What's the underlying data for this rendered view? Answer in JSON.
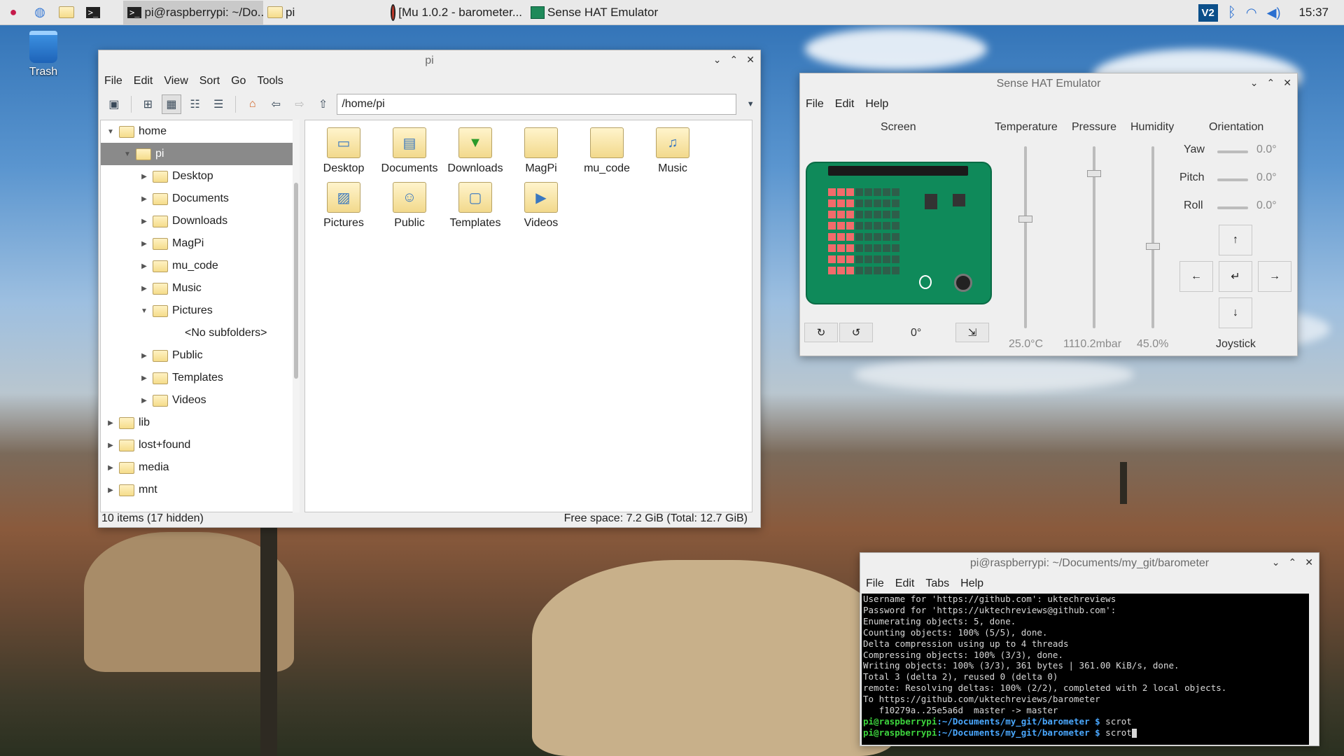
{
  "taskbar": {
    "tasks": [
      {
        "label": "pi@raspberrypi: ~/Do...",
        "active": true
      },
      {
        "label": "pi",
        "active": false
      },
      {
        "label": "[Mu 1.0.2 - barometer...",
        "active": false
      },
      {
        "label": "Sense HAT Emulator",
        "active": false
      }
    ],
    "clock": "15:37"
  },
  "desktop": {
    "trash_label": "Trash"
  },
  "file_manager": {
    "title": "pi",
    "menu": [
      "File",
      "Edit",
      "View",
      "Sort",
      "Go",
      "Tools"
    ],
    "address": "/home/pi",
    "tree": [
      {
        "label": "home",
        "level": 0,
        "expanded": true,
        "selected": false
      },
      {
        "label": "pi",
        "level": 1,
        "expanded": true,
        "selected": true
      },
      {
        "label": "Desktop",
        "level": 2,
        "expanded": false,
        "selected": false
      },
      {
        "label": "Documents",
        "level": 2,
        "expanded": false,
        "selected": false
      },
      {
        "label": "Downloads",
        "level": 2,
        "expanded": false,
        "selected": false
      },
      {
        "label": "MagPi",
        "level": 2,
        "expanded": false,
        "selected": false
      },
      {
        "label": "mu_code",
        "level": 2,
        "expanded": false,
        "selected": false
      },
      {
        "label": "Music",
        "level": 2,
        "expanded": false,
        "selected": false
      },
      {
        "label": "Pictures",
        "level": 2,
        "expanded": true,
        "selected": false
      },
      {
        "label": "<No subfolders>",
        "level": 3,
        "expanded": false,
        "selected": false
      },
      {
        "label": "Public",
        "level": 2,
        "expanded": false,
        "selected": false
      },
      {
        "label": "Templates",
        "level": 2,
        "expanded": false,
        "selected": false
      },
      {
        "label": "Videos",
        "level": 2,
        "expanded": false,
        "selected": false
      },
      {
        "label": "lib",
        "level": 0,
        "expanded": false,
        "selected": false
      },
      {
        "label": "lost+found",
        "level": 0,
        "expanded": false,
        "selected": false
      },
      {
        "label": "media",
        "level": 0,
        "expanded": false,
        "selected": false
      },
      {
        "label": "mnt",
        "level": 0,
        "expanded": false,
        "selected": false
      }
    ],
    "files": [
      {
        "label": "Desktop",
        "icon": "desktop-folder-icon"
      },
      {
        "label": "Documents",
        "icon": "documents-folder-icon"
      },
      {
        "label": "Downloads",
        "icon": "downloads-folder-icon"
      },
      {
        "label": "MagPi",
        "icon": "folder-icon"
      },
      {
        "label": "mu_code",
        "icon": "folder-icon"
      },
      {
        "label": "Music",
        "icon": "music-folder-icon"
      },
      {
        "label": "Pictures",
        "icon": "pictures-folder-icon"
      },
      {
        "label": "Public",
        "icon": "public-folder-icon"
      },
      {
        "label": "Templates",
        "icon": "templates-folder-icon"
      },
      {
        "label": "Videos",
        "icon": "videos-folder-icon"
      }
    ],
    "status_left": "10 items (17 hidden)",
    "status_right": "Free space: 7.2 GiB (Total: 12.7 GiB)"
  },
  "sense_hat": {
    "title": "Sense HAT Emulator",
    "menu": [
      "File",
      "Edit",
      "Help"
    ],
    "screen_label": "Screen",
    "rotation": "0°",
    "temperature": {
      "label": "Temperature",
      "value": "25.0°C",
      "level": 0.6
    },
    "pressure": {
      "label": "Pressure",
      "value": "1110.2mbar",
      "level": 0.85
    },
    "humidity": {
      "label": "Humidity",
      "value": "45.0%",
      "level": 0.45
    },
    "orientation": {
      "label": "Orientation",
      "yaw_label": "Yaw",
      "yaw": "0.0°",
      "pitch_label": "Pitch",
      "pitch": "0.0°",
      "roll_label": "Roll",
      "roll": "0.0°"
    },
    "joystick_label": "Joystick",
    "led_color": "#f26b6b"
  },
  "terminal": {
    "title": "pi@raspberrypi: ~/Documents/my_git/barometer",
    "menu": [
      "File",
      "Edit",
      "Tabs",
      "Help"
    ],
    "lines": [
      "Username for 'https://github.com': uktechreviews",
      "Password for 'https://uktechreviews@github.com':",
      "Enumerating objects: 5, done.",
      "Counting objects: 100% (5/5), done.",
      "Delta compression using up to 4 threads",
      "Compressing objects: 100% (3/3), done.",
      "Writing objects: 100% (3/3), 361 bytes | 361.00 KiB/s, done.",
      "Total 3 (delta 2), reused 0 (delta 0)",
      "remote: Resolving deltas: 100% (2/2), completed with 2 local objects.",
      "To https://github.com/uktechreviews/barometer",
      "   f10279a..25e5a6d  master -> master"
    ],
    "prompt_user": "pi@raspberrypi",
    "prompt_path": ":~/Documents/my_git/barometer $",
    "commands": [
      "scrot",
      "scrot"
    ]
  }
}
